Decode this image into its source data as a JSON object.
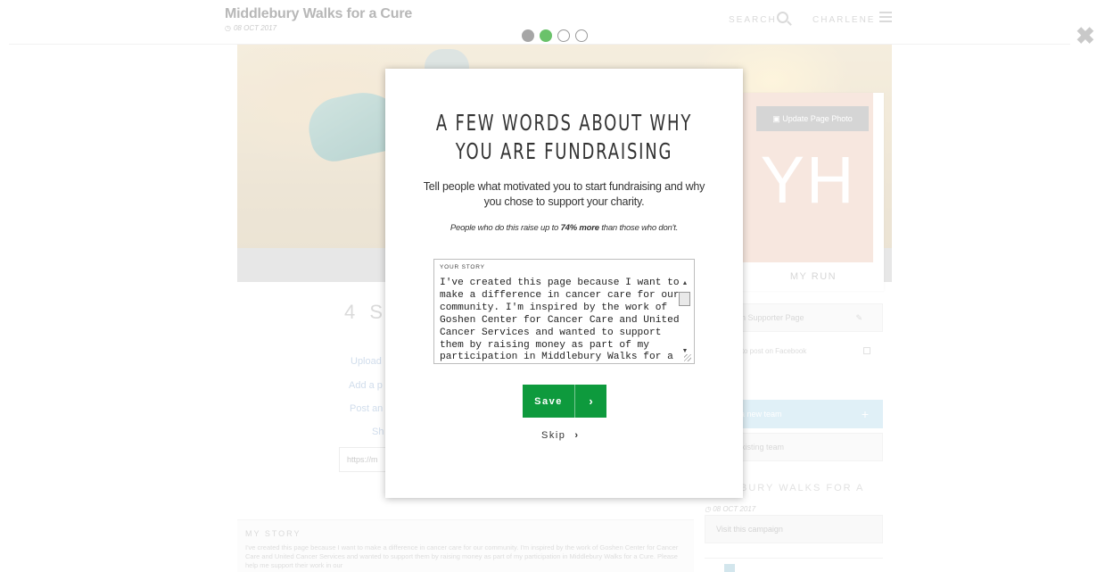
{
  "header": {
    "campaign_title": "Middlebury Walks for a Cure",
    "campaign_date": "08 OCT 2017",
    "search_label": "SEARCH",
    "user_label": "CHARLENE"
  },
  "progress": {
    "total_steps": 4,
    "current_step": 2
  },
  "background": {
    "count_heading": "4 S",
    "share_lines": [
      "Upload",
      "Add a p",
      "Post an",
      "Sh"
    ],
    "url_value": "https://m",
    "profile": {
      "initials": "YH",
      "update_photo_label": "Update Page Photo",
      "page_name": "MY RUN"
    },
    "sidebar": {
      "supporter_page_label": "n Supporter Page",
      "facebook_label": "ber to post on Facebook",
      "new_team_label": "a new team",
      "existing_team_label": "xisting team",
      "campaign_label": "BURY WALKS FOR A",
      "campaign_date": "08 OCT 2017",
      "visit_label": "Visit this campaign"
    },
    "story": {
      "label": "MY STORY",
      "text": "I've created this page because I want to make a difference in cancer care for our community. I'm inspired by the work of Goshen Center for Cancer Care and United Cancer Services and wanted to support them by raising money as part of my participation in Middlebury Walks for a Cure. Please help me support their work in our"
    }
  },
  "modal": {
    "title_line1": "A FEW WORDS ABOUT WHY",
    "title_line2": "YOU ARE FUNDRAISING",
    "description": "Tell people what motivated you to start fundraising and why you chose to support your charity.",
    "stat_prefix": "People who do this raise up to ",
    "stat_highlight": "74% more",
    "stat_suffix": " than those who don't.",
    "story_field_label": "YOUR STORY",
    "story_value": "I've created this page because I want to make a difference in cancer care for our community. I'm inspired by the work of Goshen Center for Cancer Care and United Cancer Services and wanted to support them by raising money as part of my participation in Middlebury Walks for a Cure.",
    "save_label": "Save",
    "skip_label": "Skip"
  }
}
